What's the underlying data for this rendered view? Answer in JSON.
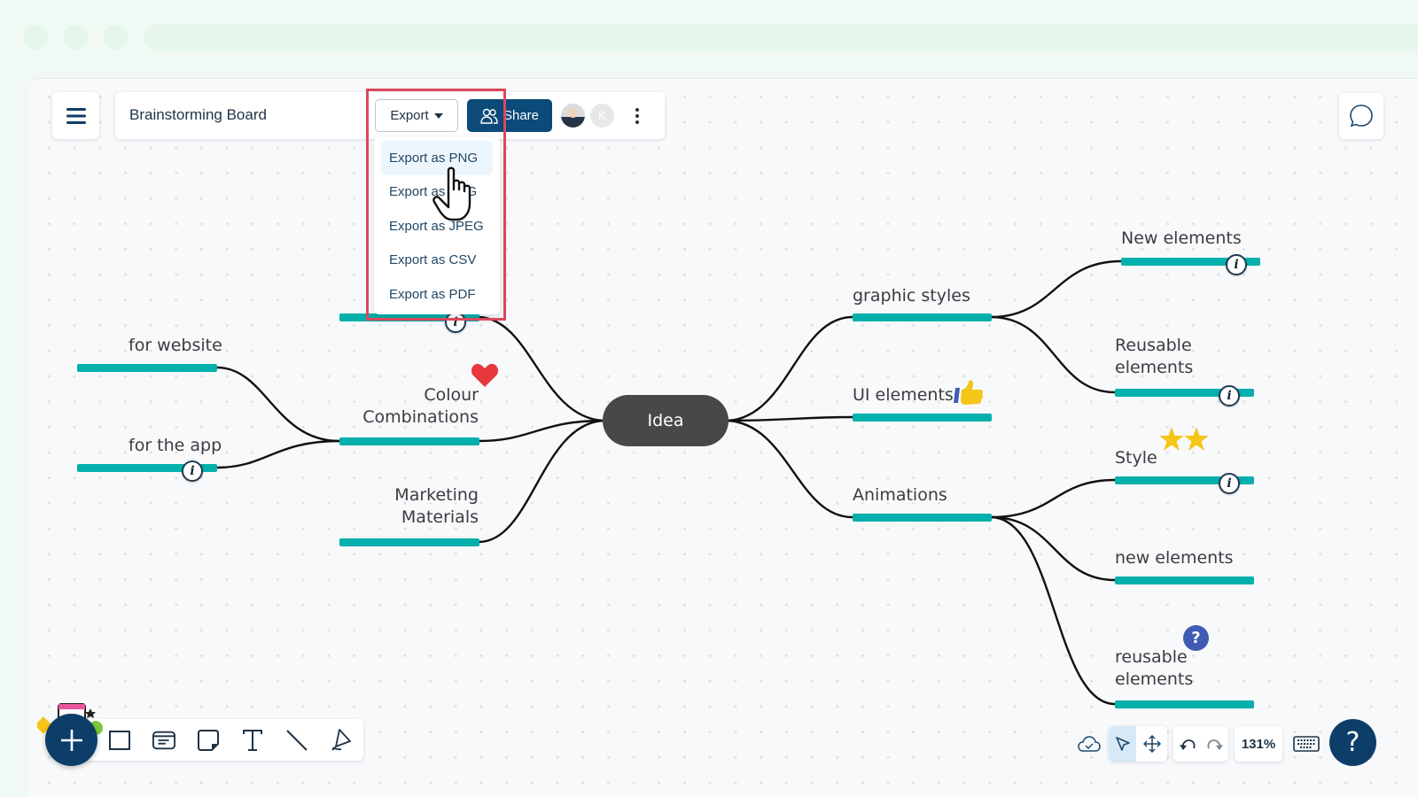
{
  "board": {
    "title": "Brainstorming Board"
  },
  "toolbar_top": {
    "export_label": "Export",
    "share_label": "Share",
    "avatar_initial": "K"
  },
  "export_menu": {
    "items": [
      {
        "label": "Export as PNG",
        "active": true
      },
      {
        "label": "Export as SVG",
        "active": false
      },
      {
        "label": "Export as JPEG",
        "active": false
      },
      {
        "label": "Export as CSV",
        "active": false
      },
      {
        "label": "Export as PDF",
        "active": false
      }
    ]
  },
  "mindmap": {
    "root": "Idea",
    "left": [
      {
        "label": "",
        "info": true
      },
      {
        "label_lines": [
          "Colour",
          "Combinations"
        ],
        "emoji": "heart",
        "children": [
          {
            "label": "for website"
          },
          {
            "label": "for the app",
            "info": true
          }
        ]
      },
      {
        "label_lines": [
          "Marketing",
          "Materials"
        ]
      }
    ],
    "right": [
      {
        "label": "graphic styles",
        "children": [
          {
            "label": "New elements",
            "info": true
          },
          {
            "label_lines": [
              "Reusable",
              "elements"
            ],
            "info": true
          }
        ]
      },
      {
        "label": "UI elements",
        "emoji": "thumbs-up"
      },
      {
        "label": "Animations",
        "children": [
          {
            "label": "Style",
            "info": true,
            "emoji": "two-stars"
          },
          {
            "label": "new elements"
          },
          {
            "label_lines": [
              "reusable",
              "elements"
            ],
            "emoji": "question"
          }
        ]
      }
    ],
    "colors": {
      "branch_bar": "#03b0ac",
      "root_fill": "#484848",
      "connector": "#111111"
    }
  },
  "bottom_bar": {
    "zoom_level": "131%",
    "help_label": "?"
  },
  "colors": {
    "primary": "#0b4a79",
    "highlight_border": "#d9485a"
  }
}
